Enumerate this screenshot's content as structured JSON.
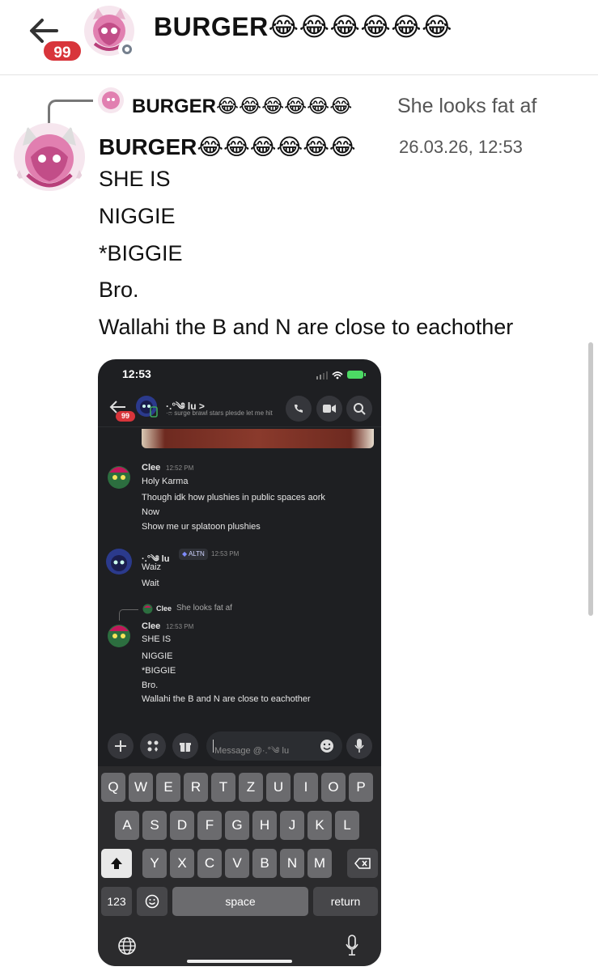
{
  "header": {
    "title": "BURGER😂😂😂😂😂😂",
    "unread_badge": "99"
  },
  "reply": {
    "author": "BURGER😂😂😂😂😂😂",
    "text": "She looks fat af"
  },
  "message": {
    "author": "BURGER😂😂😂😂😂😂",
    "timestamp": "26.03.26, 12:53",
    "lines": [
      "SHE IS",
      "NIGGIE",
      "*BIGGIE",
      "Bro.",
      "Wallahi the B and N are close to eachother"
    ]
  },
  "embedded_screenshot": {
    "status_time": "12:53",
    "chat_title": "·.°༄ lu >",
    "chat_subtitle": "·ෆ surge brawl stars plesde let me hit",
    "badge": "99",
    "messages": [
      {
        "author": "Clee",
        "time": "12:52 PM",
        "lines": [
          "Holy Karma",
          "Though idk how plushies in public spaces aork",
          "Now",
          "Show me ur splatoon plushies"
        ]
      },
      {
        "author": "·.°༄ lu",
        "tag": "ALTN",
        "time": "12:53 PM",
        "lines": [
          "Waiz",
          "Wait"
        ]
      },
      {
        "reply_author": "Clee",
        "reply_text": "She looks fat af",
        "author": "Clee",
        "time": "12:53 PM",
        "lines": [
          "SHE IS",
          "NIGGIE",
          "*BIGGIE",
          "Bro.",
          "Wallahi the B and N are close to eachother"
        ]
      }
    ],
    "input_placeholder": "Message @·.°༄ lu",
    "keyboard": {
      "row1": [
        "Q",
        "W",
        "E",
        "R",
        "T",
        "Z",
        "U",
        "I",
        "O",
        "P"
      ],
      "row2": [
        "A",
        "S",
        "D",
        "F",
        "G",
        "H",
        "J",
        "K",
        "L"
      ],
      "row3": [
        "Y",
        "X",
        "C",
        "V",
        "B",
        "N",
        "M"
      ],
      "numbers_key": "123",
      "space_key": "space",
      "return_key": "return"
    }
  },
  "colors": {
    "badge_red": "#d8353b",
    "discord_dark": "#1e1f22",
    "name_pink": "#d86aa0"
  }
}
